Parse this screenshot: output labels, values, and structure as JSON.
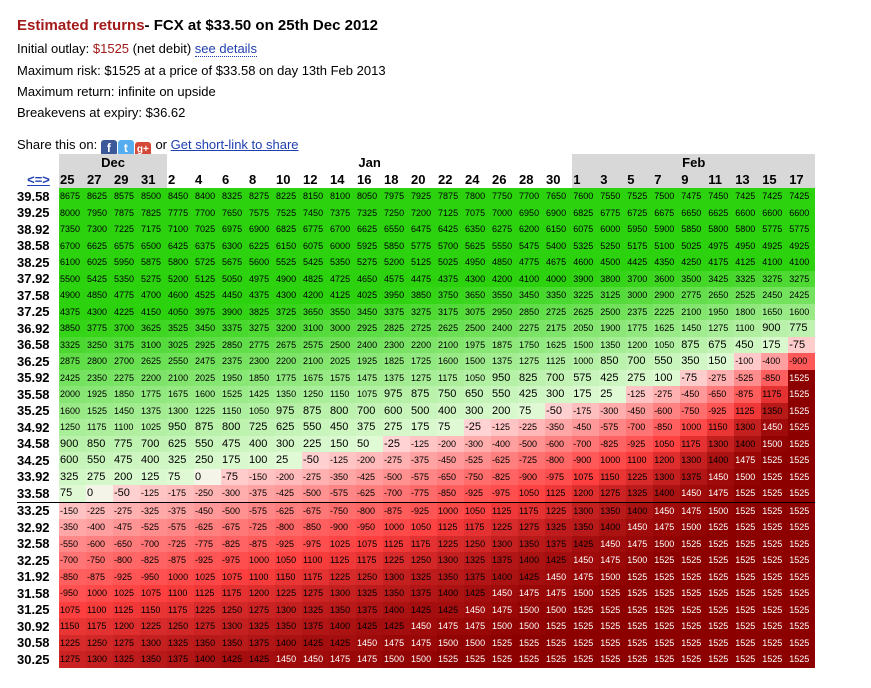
{
  "header": {
    "highlight": "Estimated returns",
    "subtitle": "- FCX at $33.50 on 25th Dec 2012"
  },
  "outlay": {
    "label": "Initial outlay: ",
    "value": "$1525",
    "suffix": " (net debit) ",
    "link": "see details"
  },
  "max_risk": "Maximum risk: $1525 at a price of $33.58 on day 13th Feb 2013",
  "max_return": "Maximum return: infinite on upside",
  "breakevens": "Breakevens at expiry: $36.62",
  "share": {
    "label": "Share this on: ",
    "or": " or ",
    "link": "Get short-link to share",
    "icons": [
      "facebook-icon",
      "twitter-icon",
      "google-plus-icon"
    ]
  },
  "colors": {
    "accent_red": "#a31a1a",
    "link_blue": "#1f3fb0",
    "header_shade": "#d8d8d8"
  },
  "table": {
    "nav": "<=>",
    "months": [
      {
        "label": "Dec",
        "span": 4,
        "shade": true
      },
      {
        "label": "Jan",
        "span": 15,
        "shade": false
      },
      {
        "label": "Feb",
        "span": 9,
        "shade": true
      }
    ],
    "days": [
      "25",
      "27",
      "29",
      "31",
      "2",
      "4",
      "6",
      "8",
      "10",
      "12",
      "14",
      "16",
      "18",
      "20",
      "22",
      "24",
      "26",
      "28",
      "30",
      "1",
      "3",
      "5",
      "7",
      "9",
      "11",
      "13",
      "15",
      "17"
    ],
    "current_price_row": "33.58",
    "rows": [
      {
        "price": "39.58",
        "v": [
          "8675",
          "8625",
          "8575",
          "8500",
          "8450",
          "8400",
          "8325",
          "8275",
          "8225",
          "8150",
          "8100",
          "8050",
          "7975",
          "7925",
          "7875",
          "7800",
          "7750",
          "7700",
          "7650",
          "7600",
          "7550",
          "7525",
          "7500",
          "7475",
          "7450",
          "7425",
          "7425",
          "7425"
        ]
      },
      {
        "price": "39.25",
        "v": [
          "8000",
          "7950",
          "7875",
          "7825",
          "7775",
          "7700",
          "7650",
          "7575",
          "7525",
          "7450",
          "7375",
          "7325",
          "7250",
          "7200",
          "7125",
          "7075",
          "7000",
          "6950",
          "6900",
          "6825",
          "6775",
          "6725",
          "6675",
          "6650",
          "6625",
          "6600",
          "6600",
          "6600"
        ]
      },
      {
        "price": "38.92",
        "v": [
          "7350",
          "7300",
          "7225",
          "7175",
          "7100",
          "7025",
          "6975",
          "6900",
          "6825",
          "6775",
          "6700",
          "6625",
          "6550",
          "6475",
          "6425",
          "6350",
          "6275",
          "6200",
          "6150",
          "6075",
          "6000",
          "5950",
          "5900",
          "5850",
          "5800",
          "5800",
          "5775",
          "5775"
        ]
      },
      {
        "price": "38.58",
        "v": [
          "6700",
          "6625",
          "6575",
          "6500",
          "6425",
          "6375",
          "6300",
          "6225",
          "6150",
          "6075",
          "6000",
          "5925",
          "5850",
          "5775",
          "5700",
          "5625",
          "5550",
          "5475",
          "5400",
          "5325",
          "5250",
          "5175",
          "5100",
          "5025",
          "4975",
          "4950",
          "4925",
          "4925"
        ]
      },
      {
        "price": "38.25",
        "v": [
          "6100",
          "6025",
          "5950",
          "5875",
          "5800",
          "5725",
          "5675",
          "5600",
          "5525",
          "5425",
          "5350",
          "5275",
          "5200",
          "5125",
          "5025",
          "4950",
          "4850",
          "4775",
          "4675",
          "4600",
          "4500",
          "4425",
          "4350",
          "4250",
          "4175",
          "4125",
          "4100",
          "4100"
        ]
      },
      {
        "price": "37.92",
        "v": [
          "5500",
          "5425",
          "5350",
          "5275",
          "5200",
          "5125",
          "5050",
          "4975",
          "4900",
          "4825",
          "4725",
          "4650",
          "4575",
          "4475",
          "4375",
          "4300",
          "4200",
          "4100",
          "4000",
          "3900",
          "3800",
          "3700",
          "3600",
          "3500",
          "3425",
          "3325",
          "3275",
          "3275"
        ]
      },
      {
        "price": "37.58",
        "v": [
          "4900",
          "4850",
          "4775",
          "4700",
          "4600",
          "4525",
          "4450",
          "4375",
          "4300",
          "4200",
          "4125",
          "4025",
          "3950",
          "3850",
          "3750",
          "3650",
          "3550",
          "3450",
          "3350",
          "3225",
          "3125",
          "3000",
          "2900",
          "2775",
          "2650",
          "2525",
          "2450",
          "2425"
        ]
      },
      {
        "price": "37.25",
        "v": [
          "4375",
          "4300",
          "4225",
          "4150",
          "4050",
          "3975",
          "3900",
          "3825",
          "3725",
          "3650",
          "3550",
          "3450",
          "3375",
          "3275",
          "3175",
          "3075",
          "2950",
          "2850",
          "2725",
          "2625",
          "2500",
          "2375",
          "2225",
          "2100",
          "1950",
          "1800",
          "1650",
          "1600"
        ]
      },
      {
        "price": "36.92",
        "v": [
          "3850",
          "3775",
          "3700",
          "3625",
          "3525",
          "3450",
          "3375",
          "3275",
          "3200",
          "3100",
          "3000",
          "2925",
          "2825",
          "2725",
          "2625",
          "2500",
          "2400",
          "2275",
          "2175",
          "2050",
          "1900",
          "1775",
          "1625",
          "1450",
          "1275",
          "1100",
          "900",
          "775"
        ]
      },
      {
        "price": "36.58",
        "v": [
          "3325",
          "3250",
          "3175",
          "3100",
          "3025",
          "2925",
          "2850",
          "2775",
          "2675",
          "2575",
          "2500",
          "2400",
          "2300",
          "2200",
          "2100",
          "1975",
          "1875",
          "1750",
          "1625",
          "1500",
          "1350",
          "1200",
          "1050",
          "875",
          "675",
          "450",
          "175",
          "-75"
        ]
      },
      {
        "price": "36.25",
        "v": [
          "2875",
          "2800",
          "2700",
          "2625",
          "2550",
          "2475",
          "2375",
          "2300",
          "2200",
          "2100",
          "2025",
          "1925",
          "1825",
          "1725",
          "1600",
          "1500",
          "1375",
          "1275",
          "1125",
          "1000",
          "850",
          "700",
          "550",
          "350",
          "150",
          "-100",
          "-400",
          "-900"
        ]
      },
      {
        "price": "35.92",
        "v": [
          "2425",
          "2350",
          "2275",
          "2200",
          "2100",
          "2025",
          "1950",
          "1850",
          "1775",
          "1675",
          "1575",
          "1475",
          "1375",
          "1275",
          "1175",
          "1050",
          "950",
          "825",
          "700",
          "575",
          "425",
          "275",
          "100",
          "-75",
          "-275",
          "-525",
          "-850",
          "1525"
        ]
      },
      {
        "price": "35.58",
        "v": [
          "2000",
          "1925",
          "1850",
          "1775",
          "1675",
          "1600",
          "1525",
          "1425",
          "1350",
          "1250",
          "1150",
          "1075",
          "975",
          "875",
          "750",
          "650",
          "550",
          "425",
          "300",
          "175",
          "25",
          "-125",
          "-275",
          "-450",
          "-650",
          "-875",
          "1175",
          "1525"
        ]
      },
      {
        "price": "35.25",
        "v": [
          "1600",
          "1525",
          "1450",
          "1375",
          "1300",
          "1225",
          "1150",
          "1050",
          "975",
          "875",
          "800",
          "700",
          "600",
          "500",
          "400",
          "300",
          "200",
          "75",
          "-50",
          "-175",
          "-300",
          "-450",
          "-600",
          "-750",
          "-925",
          "1125",
          "1350",
          "1525"
        ]
      },
      {
        "price": "34.92",
        "v": [
          "1250",
          "1175",
          "1100",
          "1025",
          "950",
          "875",
          "800",
          "725",
          "625",
          "550",
          "450",
          "375",
          "275",
          "175",
          "75",
          "-25",
          "-125",
          "-225",
          "-350",
          "-450",
          "-575",
          "-700",
          "-850",
          "1000",
          "1150",
          "1300",
          "1450",
          "1525"
        ]
      },
      {
        "price": "34.58",
        "v": [
          "900",
          "850",
          "775",
          "700",
          "625",
          "550",
          "475",
          "400",
          "300",
          "225",
          "150",
          "50",
          "-25",
          "-125",
          "-200",
          "-300",
          "-400",
          "-500",
          "-600",
          "-700",
          "-825",
          "-925",
          "1050",
          "1175",
          "1300",
          "1400",
          "1500",
          "1525"
        ]
      },
      {
        "price": "34.25",
        "v": [
          "600",
          "550",
          "475",
          "400",
          "325",
          "250",
          "175",
          "100",
          "25",
          "-50",
          "-125",
          "-200",
          "-275",
          "-375",
          "-450",
          "-525",
          "-625",
          "-725",
          "-800",
          "-900",
          "1000",
          "1100",
          "1200",
          "1300",
          "1400",
          "1475",
          "1525",
          "1525"
        ]
      },
      {
        "price": "33.92",
        "v": [
          "325",
          "275",
          "200",
          "125",
          "75",
          "0",
          "-75",
          "-150",
          "-200",
          "-275",
          "-350",
          "-425",
          "-500",
          "-575",
          "-650",
          "-750",
          "-825",
          "-900",
          "-975",
          "1075",
          "1150",
          "1225",
          "1300",
          "1375",
          "1450",
          "1500",
          "1525",
          "1525"
        ]
      },
      {
        "price": "33.58",
        "v": [
          "75",
          "0",
          "-50",
          "-125",
          "-175",
          "-250",
          "-300",
          "-375",
          "-425",
          "-500",
          "-575",
          "-625",
          "-700",
          "-775",
          "-850",
          "-925",
          "-975",
          "1050",
          "1125",
          "1200",
          "1275",
          "1325",
          "1400",
          "1450",
          "1475",
          "1525",
          "1525",
          "1525"
        ]
      },
      {
        "price": "33.25",
        "v": [
          "-150",
          "-225",
          "-275",
          "-325",
          "-375",
          "-450",
          "-500",
          "-575",
          "-625",
          "-675",
          "-750",
          "-800",
          "-875",
          "-925",
          "1000",
          "1050",
          "1125",
          "1175",
          "1225",
          "1300",
          "1350",
          "1400",
          "1450",
          "1475",
          "1500",
          "1525",
          "1525",
          "1525"
        ]
      },
      {
        "price": "32.92",
        "v": [
          "-350",
          "-400",
          "-475",
          "-525",
          "-575",
          "-625",
          "-675",
          "-725",
          "-800",
          "-850",
          "-900",
          "-950",
          "1000",
          "1050",
          "1125",
          "1175",
          "1225",
          "1275",
          "1325",
          "1350",
          "1400",
          "1450",
          "1475",
          "1500",
          "1525",
          "1525",
          "1525",
          "1525"
        ]
      },
      {
        "price": "32.58",
        "v": [
          "-550",
          "-600",
          "-650",
          "-700",
          "-725",
          "-775",
          "-825",
          "-875",
          "-925",
          "-975",
          "1025",
          "1075",
          "1125",
          "1175",
          "1225",
          "1250",
          "1300",
          "1350",
          "1375",
          "1425",
          "1450",
          "1475",
          "1500",
          "1525",
          "1525",
          "1525",
          "1525",
          "1525"
        ]
      },
      {
        "price": "32.25",
        "v": [
          "-700",
          "-750",
          "-800",
          "-825",
          "-875",
          "-925",
          "-975",
          "1000",
          "1050",
          "1100",
          "1125",
          "1175",
          "1225",
          "1250",
          "1300",
          "1325",
          "1375",
          "1400",
          "1425",
          "1450",
          "1475",
          "1500",
          "1525",
          "1525",
          "1525",
          "1525",
          "1525",
          "1525"
        ]
      },
      {
        "price": "31.92",
        "v": [
          "-850",
          "-875",
          "-925",
          "-950",
          "1000",
          "1025",
          "1075",
          "1100",
          "1150",
          "1175",
          "1225",
          "1250",
          "1300",
          "1325",
          "1350",
          "1375",
          "1400",
          "1425",
          "1450",
          "1475",
          "1500",
          "1525",
          "1525",
          "1525",
          "1525",
          "1525",
          "1525",
          "1525"
        ]
      },
      {
        "price": "31.58",
        "v": [
          "-950",
          "1000",
          "1025",
          "1075",
          "1100",
          "1125",
          "1175",
          "1200",
          "1225",
          "1275",
          "1300",
          "1325",
          "1350",
          "1375",
          "1400",
          "1425",
          "1450",
          "1475",
          "1475",
          "1500",
          "1525",
          "1525",
          "1525",
          "1525",
          "1525",
          "1525",
          "1525",
          "1525"
        ]
      },
      {
        "price": "31.25",
        "v": [
          "1075",
          "1100",
          "1125",
          "1150",
          "1175",
          "1225",
          "1250",
          "1275",
          "1300",
          "1325",
          "1350",
          "1375",
          "1400",
          "1425",
          "1425",
          "1450",
          "1475",
          "1500",
          "1500",
          "1525",
          "1525",
          "1525",
          "1525",
          "1525",
          "1525",
          "1525",
          "1525",
          "1525"
        ]
      },
      {
        "price": "30.92",
        "v": [
          "1150",
          "1175",
          "1200",
          "1225",
          "1250",
          "1275",
          "1300",
          "1325",
          "1350",
          "1375",
          "1400",
          "1425",
          "1425",
          "1450",
          "1475",
          "1475",
          "1500",
          "1500",
          "1525",
          "1525",
          "1525",
          "1525",
          "1525",
          "1525",
          "1525",
          "1525",
          "1525",
          "1525"
        ]
      },
      {
        "price": "30.58",
        "v": [
          "1225",
          "1250",
          "1275",
          "1300",
          "1325",
          "1350",
          "1350",
          "1375",
          "1400",
          "1425",
          "1425",
          "1450",
          "1475",
          "1475",
          "1500",
          "1500",
          "1525",
          "1525",
          "1525",
          "1525",
          "1525",
          "1525",
          "1525",
          "1525",
          "1525",
          "1525",
          "1525",
          "1525"
        ]
      },
      {
        "price": "30.25",
        "v": [
          "1275",
          "1300",
          "1325",
          "1350",
          "1375",
          "1400",
          "1425",
          "1425",
          "1450",
          "1450",
          "1475",
          "1475",
          "1500",
          "1500",
          "1525",
          "1525",
          "1525",
          "1525",
          "1525",
          "1525",
          "1525",
          "1525",
          "1525",
          "1525",
          "1525",
          "1525",
          "1525",
          "1525"
        ]
      }
    ]
  }
}
